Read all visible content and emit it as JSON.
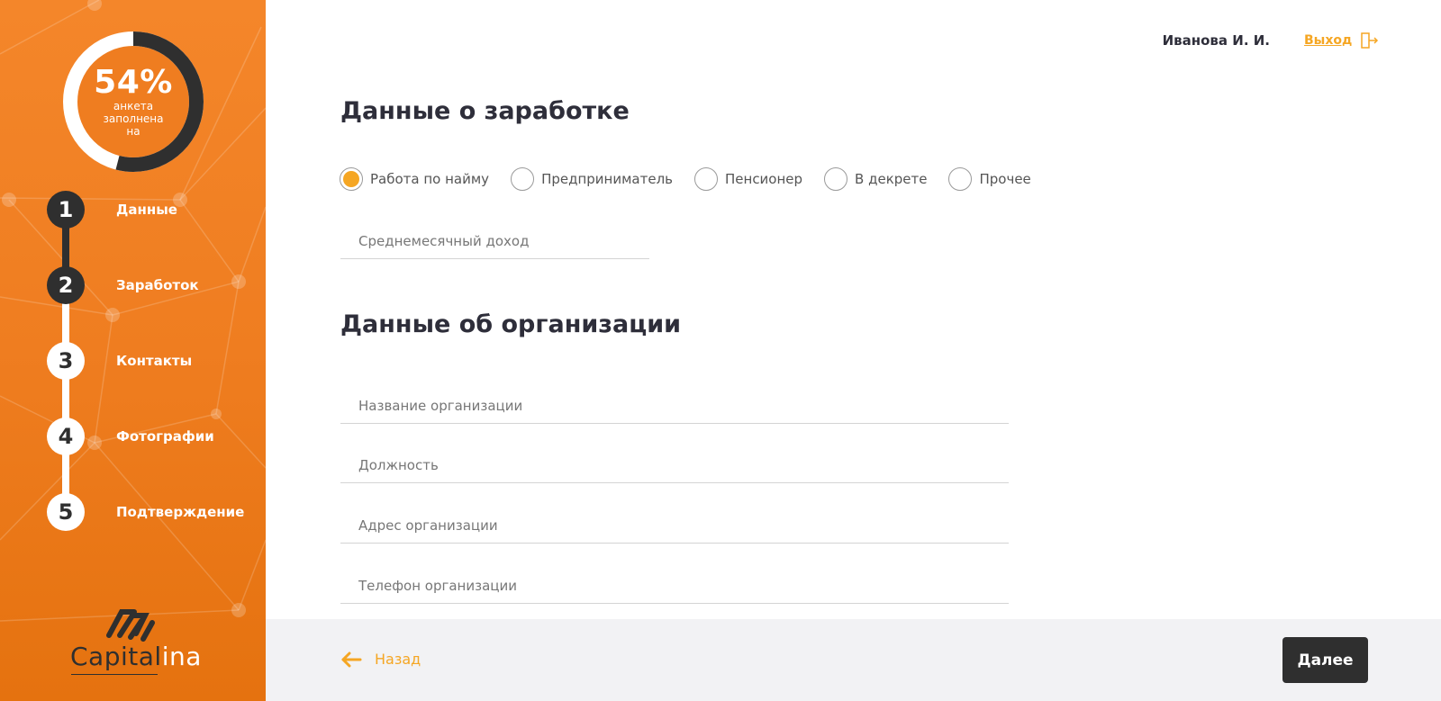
{
  "sidebar": {
    "progress": {
      "percent_label": "54%",
      "caption": "анкета заполнена на",
      "fraction": 0.54
    },
    "steps": [
      {
        "number": "1",
        "label": "Данные",
        "state": "done"
      },
      {
        "number": "2",
        "label": "Заработок",
        "state": "current"
      },
      {
        "number": "3",
        "label": "Контакты",
        "state": "todo"
      },
      {
        "number": "4",
        "label": "Фотографии",
        "state": "todo"
      },
      {
        "number": "5",
        "label": "Подтверждение",
        "state": "todo"
      }
    ],
    "logo": {
      "text_dark": "Capital",
      "text_light": "ina"
    }
  },
  "header": {
    "user_name": "Иванова И. И.",
    "logout_label": "Выход"
  },
  "income": {
    "title": "Данные о заработке",
    "employment_options": [
      {
        "label": "Работа по найму",
        "selected": true
      },
      {
        "label": "Предприниматель",
        "selected": false
      },
      {
        "label": "Пенсионер",
        "selected": false
      },
      {
        "label": "В декрете",
        "selected": false
      },
      {
        "label": "Прочее",
        "selected": false
      }
    ],
    "monthly_income": {
      "placeholder": "Среднемесячный доход",
      "value": ""
    }
  },
  "organization": {
    "title": "Данные об организации",
    "name": {
      "placeholder": "Название организации",
      "value": ""
    },
    "position": {
      "placeholder": "Должность",
      "value": ""
    },
    "address": {
      "placeholder": "Адрес организации",
      "value": ""
    },
    "phone": {
      "placeholder": "Телефон организации",
      "value": ""
    }
  },
  "footer": {
    "back_label": "Назад",
    "next_label": "Далее"
  },
  "colors": {
    "accent": "#f5a623",
    "sidebar": "#ef7d20",
    "dark": "#2f2f2f"
  }
}
